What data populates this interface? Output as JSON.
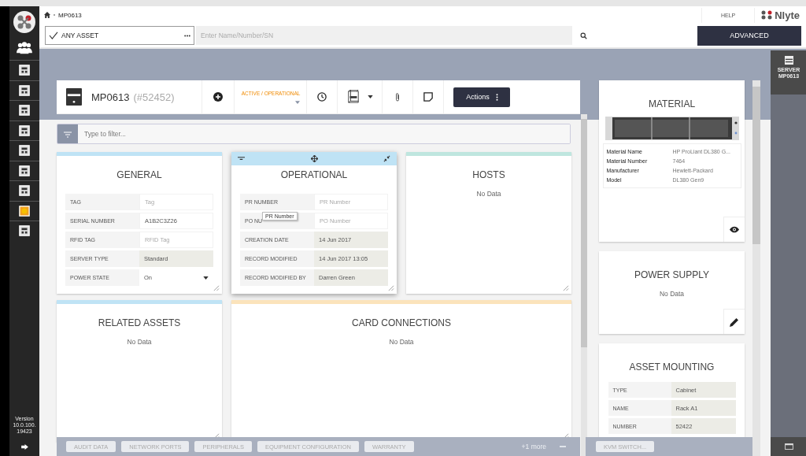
{
  "breadcrumb": {
    "current": "MP0613"
  },
  "help": "HELP",
  "brand": "Nlyte",
  "search": {
    "scope": "ANY ASSET",
    "placeholder": "Enter Name/Number/SN"
  },
  "advanced_button": "ADVANCED",
  "sidebar": {
    "version": "Version 10.0.100. 19423"
  },
  "asset": {
    "name": "MP0613",
    "id": "(#52452)",
    "status": "ACTIVE / OPERATIONAL",
    "actions": "Actions"
  },
  "filter": {
    "placeholder": "Type to filter..."
  },
  "cards": [
    {
      "title": "GENERAL",
      "color": "#bfe3f5",
      "hovered": false,
      "wide": false,
      "fields": [
        {
          "label": "TAG",
          "placeholder": "Tag",
          "kind": "input"
        },
        {
          "label": "SERIAL NUMBER",
          "value": "A1B2C3Z26",
          "kind": "input"
        },
        {
          "label": "RFID TAG",
          "placeholder": "RFID Tag",
          "kind": "input"
        },
        {
          "label": "SERVER TYPE",
          "value": "Standard",
          "kind": "readonly"
        },
        {
          "label": "POWER STATE",
          "value": "On",
          "kind": "select"
        }
      ]
    },
    {
      "title": "OPERATIONAL",
      "color": "#bfe3f5",
      "hovered": true,
      "wide": false,
      "fields": [
        {
          "label": "PR NUMBER",
          "placeholder": "PR Number",
          "kind": "input"
        },
        {
          "label": "PO NU",
          "placeholder": "PO Number",
          "kind": "input"
        },
        {
          "label": "CREATION DATE",
          "value": "14 Jun 2017",
          "kind": "readonly"
        },
        {
          "label": "RECORD MODIFIED",
          "value": "14 Jun 2017 13:05",
          "kind": "readonly"
        },
        {
          "label": "RECORD MODIFIED BY",
          "value": "Darren Green",
          "kind": "readonly"
        }
      ]
    },
    {
      "title": "HOSTS",
      "color": "#bfe6df",
      "hovered": false,
      "wide": false,
      "empty": "No Data"
    },
    {
      "title": "RELATED ASSETS",
      "color": "#bfe3f5",
      "hovered": false,
      "wide": false,
      "empty": "No Data"
    },
    {
      "title": "CARD CONNECTIONS",
      "color": "#fbe3bb",
      "hovered": false,
      "wide": true,
      "empty": "No Data"
    }
  ],
  "tooltip": "PR Number",
  "bottom_tabs": [
    "AUDIT DATA",
    "NETWORK PORTS",
    "PERIPHERALS",
    "EQUIPMENT CONFIGURATION",
    "WARRANTY"
  ],
  "more_tabs": "+1 more",
  "material": {
    "title": "MATERIAL",
    "properties": [
      {
        "label": "Material Name",
        "value": "HP ProLiant DL380 G..."
      },
      {
        "label": "Material Number",
        "value": "7464"
      },
      {
        "label": "Manufacturer",
        "value": "Hewlett-Packard"
      },
      {
        "label": "Model",
        "value": "DL380 Gen9"
      }
    ]
  },
  "power_supply": {
    "title": "POWER SUPPLY",
    "empty": "No Data"
  },
  "mounting": {
    "title": "ASSET MOUNTING",
    "fields": [
      {
        "label": "TYPE",
        "value": "Cabinet"
      },
      {
        "label": "NAME",
        "value": "Rack A1"
      },
      {
        "label": "NUMBER",
        "value": "52422"
      }
    ]
  },
  "side_tabs": [
    "KVM SWITCH..."
  ],
  "dock": {
    "label": "SERVER MP0613"
  }
}
